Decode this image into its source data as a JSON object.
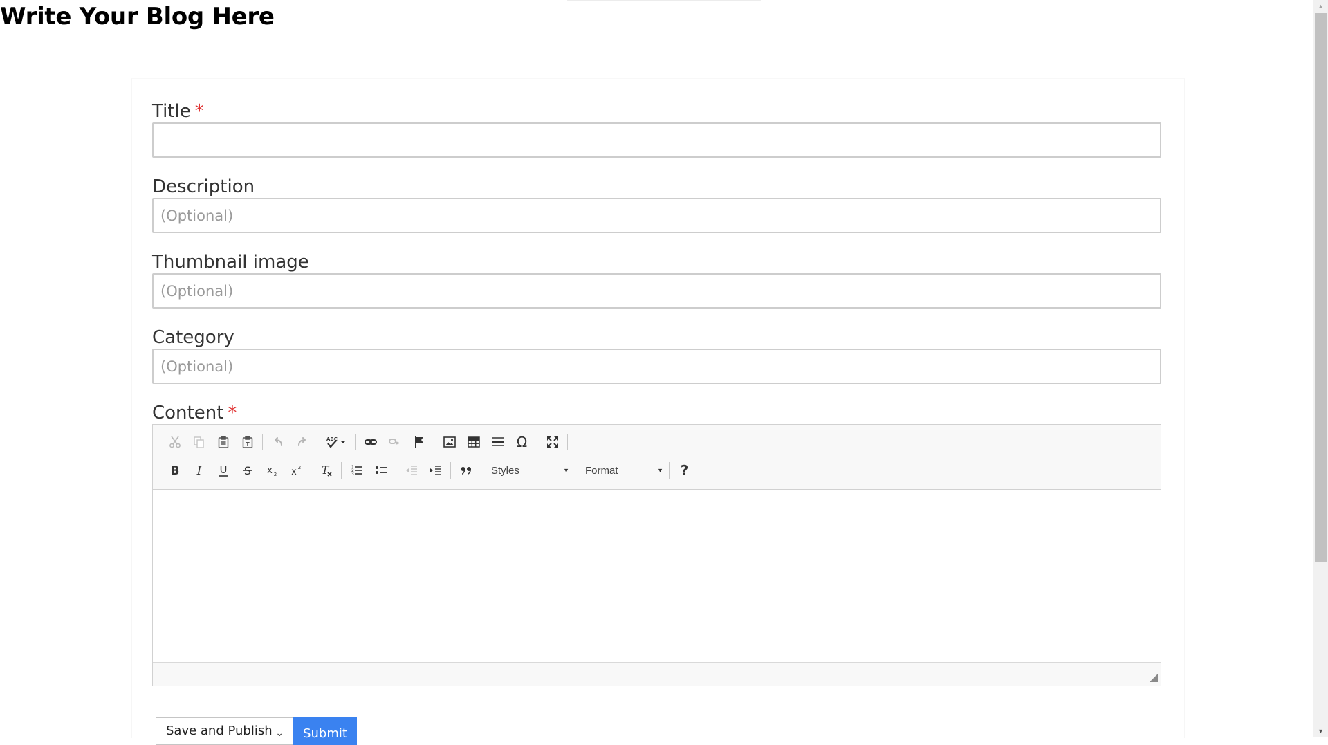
{
  "page": {
    "title": "Write Your Blog Here"
  },
  "form": {
    "title_label": "Title",
    "required_mark": "*",
    "description_label": "Description",
    "description_placeholder": "(Optional)",
    "thumbnail_label": "Thumbnail image",
    "thumbnail_placeholder": "(Optional)",
    "category_label": "Category",
    "category_placeholder": "(Optional)",
    "content_label": "Content"
  },
  "editor": {
    "toolbar_row1": [
      "cut-icon",
      "copy-icon",
      "paste-icon",
      "paste-text-icon",
      "undo-icon",
      "redo-icon",
      "spellcheck-icon",
      "link-icon",
      "unlink-icon",
      "anchor-icon",
      "image-icon",
      "table-icon",
      "horizontal-line-icon",
      "special-char-icon",
      "maximize-icon"
    ],
    "toolbar_row2": [
      "bold-icon",
      "italic-icon",
      "underline-icon",
      "strikethrough-icon",
      "subscript-icon",
      "superscript-icon",
      "remove-format-icon",
      "numbered-list-icon",
      "bulleted-list-icon",
      "outdent-icon",
      "indent-icon",
      "blockquote-icon",
      "help-icon"
    ],
    "styles_label": "Styles",
    "format_label": "Format",
    "special_char_glyph": "Ω",
    "help_glyph": "?"
  },
  "actions": {
    "publish_option": "Save and Publish",
    "submit_label": "Submit"
  },
  "colors": {
    "required": "#e03030",
    "submit_bg": "#3a82f0",
    "input_border": "#cdcdcd",
    "toolbar_bg": "#f8f8f8"
  }
}
